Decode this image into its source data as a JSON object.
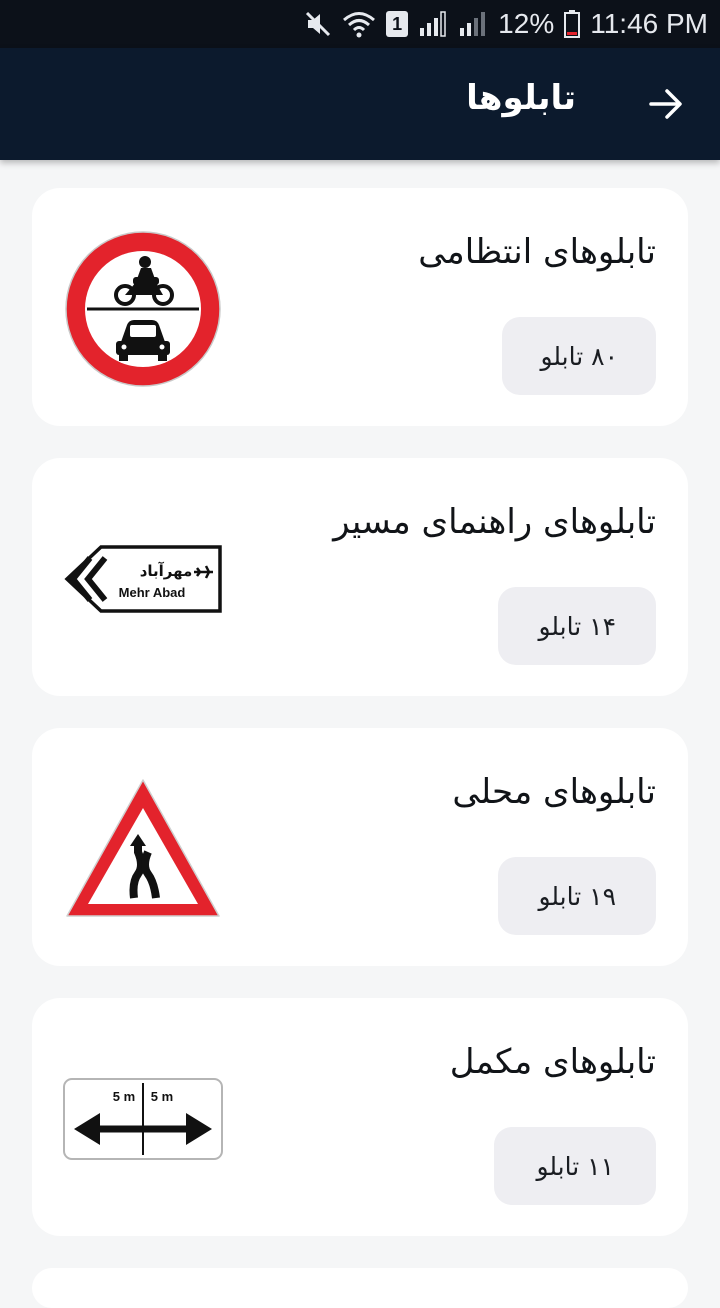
{
  "status_bar": {
    "battery_percent": "12%",
    "time": "11:46 PM",
    "sim_badge": "1",
    "icons": [
      "mute-icon",
      "wifi-icon",
      "sim-badge-icon",
      "signal-r-icon",
      "signal-r-icon",
      "battery-icon"
    ]
  },
  "app_bar": {
    "title": "تابلوها",
    "back_icon": "arrow-right-icon"
  },
  "categories": [
    {
      "title": "تابلوهای انتظامی",
      "count_label": "۸۰ تابلو",
      "sign_icon": "no-vehicles-sign-icon"
    },
    {
      "title": "تابلوهای راهنمای مسیر",
      "count_label": "۱۴ تابلو",
      "sign_icon": "direction-sign-icon",
      "sign_text_fa": "مهرآباد",
      "sign_text_en": "Mehr Abad"
    },
    {
      "title": "تابلوهای محلی",
      "count_label": "۱۹ تابلو",
      "sign_icon": "road-narrows-warning-sign-icon"
    },
    {
      "title": "تابلوهای مکمل",
      "count_label": "۱۱ تابلو",
      "sign_icon": "distance-plate-sign-icon",
      "sign_text_left": "5 m",
      "sign_text_right": "5 m"
    }
  ],
  "colors": {
    "status_bar": "#0c1119",
    "app_bar": "#0c1a2d",
    "background": "#f5f6f7",
    "card": "#ffffff",
    "chip": "#eeeef2",
    "sign_red": "#e3232c"
  }
}
